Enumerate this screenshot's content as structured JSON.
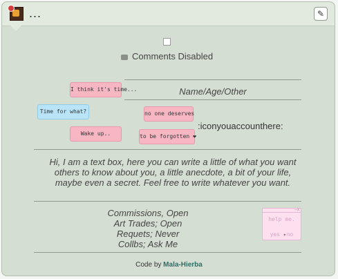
{
  "header": {
    "menu_label": "...",
    "edit_icon": "pencil-icon"
  },
  "comments": {
    "label": "Comments Disabled",
    "checked": false
  },
  "pills": {
    "think": "I think it's time...",
    "time_what": "Time for what?",
    "wake_up": "Wake up..",
    "no_one": "no one deserves",
    "forgotten": "to be forgotten ❤"
  },
  "profile": {
    "name_age": "Name/Age/Other",
    "handle": ":iconyouaccounthere:",
    "bio": "Hi, I am a text box, here you can write a little of what you want others to know about you, a little anecdote, a bit of your life, maybe even a secret. Feel free to write whatever you want.",
    "status": [
      "Commissions, Open",
      "Art Trades; Open",
      "Requets; Never",
      "Collbs; Ask Me"
    ]
  },
  "mini_window": {
    "title_controls": "--x",
    "prompt": "help me.",
    "yes": "yes",
    "arrow": "▸",
    "no": "no"
  },
  "credit": {
    "prefix": "Code by",
    "author": "Mala-Hierba"
  },
  "colors": {
    "panel": "#d5ded2",
    "pink_pill": "#f6b7c3",
    "blue_pill": "#b9e4f7",
    "credit_link": "#2f6e64"
  }
}
